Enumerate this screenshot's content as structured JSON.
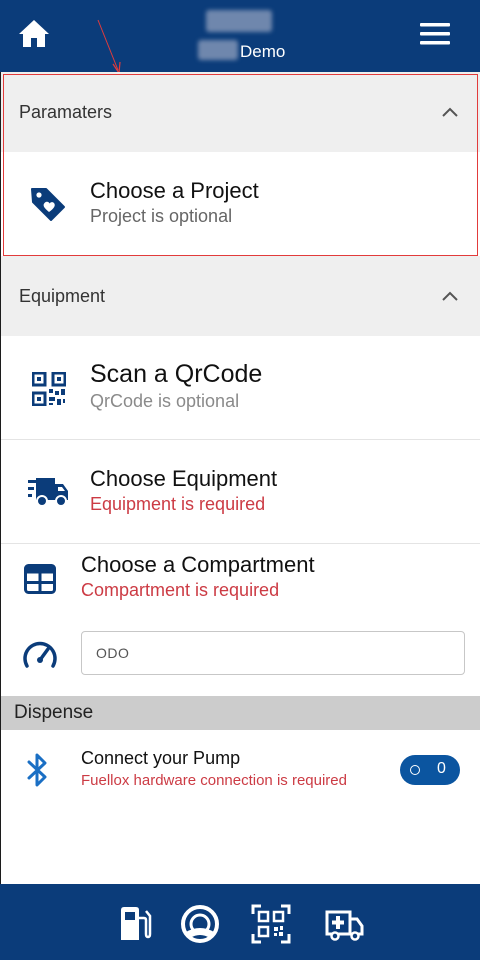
{
  "header": {
    "title_suffix": "Demo",
    "home_icon": "home-icon",
    "menu_icon": "hamburger-menu-icon",
    "color": "#0b3c7a"
  },
  "parameters": {
    "title": "Paramaters",
    "project": {
      "title": "Choose a Project",
      "subtitle": "Project is optional",
      "icon": "tag-heart-icon"
    }
  },
  "equipment": {
    "title": "Equipment",
    "qrcode": {
      "title": "Scan a QrCode",
      "subtitle": "QrCode is optional",
      "icon": "qrcode-icon"
    },
    "equipment": {
      "title": "Choose Equipment",
      "subtitle": "Equipment is required",
      "icon": "truck-icon"
    },
    "compartment": {
      "title": "Choose a Compartment",
      "subtitle": "Compartment is required",
      "icon": "grid-icon"
    },
    "odo": {
      "placeholder": "ODO",
      "icon": "speedometer-icon"
    }
  },
  "dispense": {
    "title": "Dispense",
    "pump": {
      "title": "Connect your Pump",
      "subtitle": "Fuellox hardware connection is required",
      "icon": "bluetooth-icon",
      "toggle_value": "0"
    }
  },
  "footer": {
    "buttons": [
      "fuel-pump-icon",
      "lifebuoy-icon",
      "qrcode-icon",
      "ambulance-icon"
    ]
  },
  "colors": {
    "brand": "#0b3c7a",
    "required": "#cc3b44",
    "section_bg": "#efefef",
    "dispense_bg": "#cccccc",
    "annotation": "#e23b3b"
  }
}
